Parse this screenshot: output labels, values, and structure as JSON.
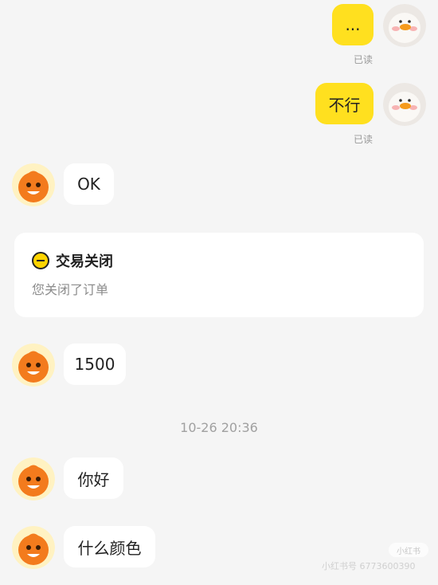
{
  "messages": [
    {
      "side": "mine",
      "text": "...",
      "status": "已读"
    },
    {
      "side": "mine",
      "text": "不行",
      "status": "已读"
    },
    {
      "side": "theirs",
      "text": "OK"
    },
    {
      "side": "theirs",
      "text": "1500"
    },
    {
      "side": "theirs",
      "text": "你好"
    },
    {
      "side": "theirs",
      "text": "什么颜色"
    }
  ],
  "system_card": {
    "icon": "minus-circle-icon",
    "title": "交易关闭",
    "subtitle": "您关闭了订单"
  },
  "timestamp": "10-26 20:36",
  "watermark": {
    "badge": "小红书",
    "text": "小红书号 6773600390"
  },
  "colors": {
    "background": "#f5f5f5",
    "my_bubble": "#ffe01f",
    "their_bubble": "#ffffff",
    "read_status": "#9a9a9a"
  },
  "avatars": {
    "mine": "duck-avatar-icon",
    "theirs": "orange-mascot-avatar-icon"
  }
}
